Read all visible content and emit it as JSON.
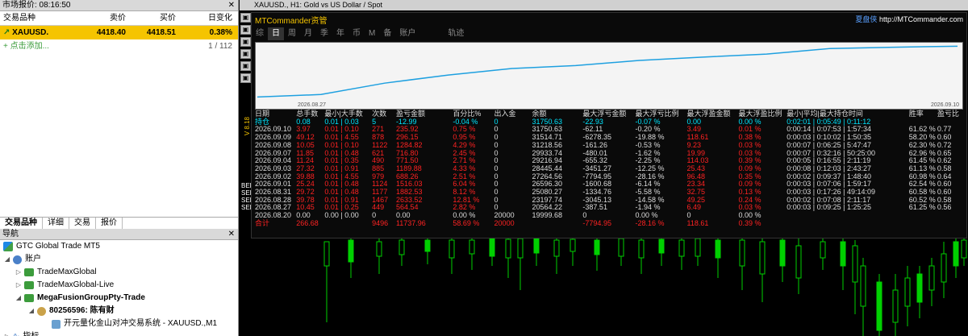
{
  "market_watch": {
    "title": "市场报价: 08:16:50",
    "columns": [
      "交易品种",
      "卖价",
      "买价",
      "日变化"
    ],
    "rows": [
      {
        "symbol": "XAUUSD.",
        "bid": "4418.40",
        "ask": "4418.51",
        "change": "0.38%"
      }
    ],
    "add_label": "+ 点击添加...",
    "count": "1 / 112",
    "tabs": [
      "交易品种",
      "详细",
      "交易",
      "报价"
    ]
  },
  "navigator": {
    "title": "导航",
    "broker": "GTC Global Trade MT5",
    "accounts_label": "账户",
    "accounts": [
      "TradeMaxGlobal",
      "TradeMaxGlobal-Live",
      "MegaFusionGroupPty-Trade"
    ],
    "user": "80256596: 陈有财",
    "ea": "开元量化金山对冲交易系统 - XAUUSD.,M1",
    "indicators": "指标"
  },
  "chart": {
    "title": "XAUUSD., H1:  Gold vs US Dollar / Spot",
    "vertical_label": "V 8.18",
    "side_text": [
      "BEE",
      "SEL",
      "SEL",
      "SEL"
    ]
  },
  "mtc": {
    "title": "MTCommander资管",
    "link_brand": "夏盘侠",
    "link_url": "http://MTCommander.com",
    "tabs": [
      "综",
      "日",
      "周",
      "月",
      "季",
      "年",
      "币",
      "M",
      "备",
      "账户",
      "轨迹"
    ],
    "active_tab": "日",
    "eq_start_date": "2026.08.27",
    "eq_end_date": "2026.09.10",
    "table": {
      "headers": [
        "日期",
        "总手数",
        "最小|大手数",
        "次数",
        "盈亏金额",
        "百分比%",
        "出入金",
        "余额",
        "最大浮亏金额",
        "最大浮亏比例",
        "最大浮盈金额",
        "最大浮盈比例",
        "最小|平均|最大持仓时间",
        "胜率",
        "盈亏比"
      ],
      "holding": [
        "持仓",
        "0.08",
        "0.01 | 0.03",
        "5",
        "-12.99",
        "-0.04 %",
        "0",
        "31750.63",
        "-22.93",
        "-0.07 %",
        "0.00",
        "0.00 %",
        "0:02:01 | 0:05:49 | 0:11:12",
        "",
        ""
      ],
      "rows": [
        [
          "2026.09.10",
          "3.97",
          "0.01 | 0.10",
          "271",
          "235.92",
          "0.75 %",
          "0",
          "31750.63",
          "-62.11",
          "-0.20 %",
          "3.49",
          "0.01 %",
          "0:00:14 | 0:07:53 | 1:57:34",
          "61.62 %",
          "0.77"
        ],
        [
          "2026.09.09",
          "49.12",
          "0.01 | 4.55",
          "878",
          "296.15",
          "0.95 %",
          "0",
          "31514.71",
          "-6278.35",
          "-19.88 %",
          "118.61",
          "0.38 %",
          "0:00:03 | 0:10:02 | 1:50:35",
          "58.20 %",
          "0.60"
        ],
        [
          "2026.09.08",
          "10.05",
          "0.01 | 0.10",
          "1122",
          "1284.82",
          "4.29 %",
          "0",
          "31218.56",
          "-161.26",
          "-0.53 %",
          "9.23",
          "0.03 %",
          "0:00:07 | 0:06:25 | 5:47:47",
          "62.30 %",
          "0.72"
        ],
        [
          "2026.09.07",
          "11.85",
          "0.01 | 0.48",
          "621",
          "716.80",
          "2.45 %",
          "0",
          "29933.74",
          "-480.01",
          "-1.62 %",
          "19.99",
          "0.03 %",
          "0:00:07 | 0:32:16 | 50:25:00",
          "62.96 %",
          "0.65"
        ],
        [
          "2026.09.04",
          "11.24",
          "0.01 | 0.35",
          "490",
          "771.50",
          "2.71 %",
          "0",
          "29216.94",
          "-655.32",
          "-2.25 %",
          "114.03",
          "0.39 %",
          "0:00:05 | 0:16:55 | 2:11:19",
          "61.45 %",
          "0.62"
        ],
        [
          "2026.09.03",
          "27.32",
          "0.01 | 0.91",
          "885",
          "1189.88",
          "4.33 %",
          "0",
          "28445.44",
          "-3451.27",
          "-12.25 %",
          "25.43",
          "0.09 %",
          "0:00:08 | 0:12:03 | 2:43:27",
          "61.13 %",
          "0.58"
        ],
        [
          "2026.09.02",
          "39.88",
          "0.01 | 4.55",
          "979",
          "688.26",
          "2.51 %",
          "0",
          "27264.56",
          "-7794.95",
          "-28.16 %",
          "96.48",
          "0.35 %",
          "0:00:02 | 0:09:37 | 1:48:40",
          "60.98 %",
          "0.64"
        ],
        [
          "2026.09.01",
          "25.24",
          "0.01 | 0.48",
          "1124",
          "1516.03",
          "6.04 %",
          "0",
          "26596.30",
          "-1600.68",
          "-6.14 %",
          "23.34",
          "0.09 %",
          "0:00:03 | 0:07:06 | 1:59:17",
          "62.54 %",
          "0.60"
        ],
        [
          "2026.08.31",
          "29.72",
          "0.01 | 0.48",
          "1177",
          "1882.53",
          "8.12 %",
          "0",
          "25080.27",
          "-1334.76",
          "-5.58 %",
          "32.75",
          "0.13 %",
          "0:00:03 | 0:17:26 | 49:14:09",
          "60.58 %",
          "0.60"
        ],
        [
          "2026.08.28",
          "39.78",
          "0.01 | 0.91",
          "1467",
          "2633.52",
          "12.81 %",
          "0",
          "23197.74",
          "-3045.13",
          "-14.58 %",
          "49.25",
          "0.24 %",
          "0:00:02 | 0:07:08 | 2:11:17",
          "60.52 %",
          "0.58"
        ],
        [
          "2026.08.27",
          "10.45",
          "0.01 | 0.25",
          "449",
          "564.54",
          "2.82 %",
          "0",
          "20564.22",
          "-387.51",
          "-1.94 %",
          "6.49",
          "0.03 %",
          "0:00:03 | 0:09:25 | 1:25:25",
          "61.25 %",
          "0.56"
        ]
      ],
      "start_row": [
        "2026.08.20",
        "0.00",
        "0.00 | 0.00",
        "0",
        "0.00",
        "0.00 %",
        "20000",
        "19999.68",
        "0",
        "0.00 %",
        "0",
        "0.00 %",
        "",
        "",
        ""
      ],
      "total": [
        "合计",
        "266.68",
        "",
        "9496",
        "11737.96",
        "58.69 %",
        "20000",
        "",
        "-7794.95",
        "-28.16 %",
        "118.61",
        "0.39 %",
        "",
        "",
        ""
      ]
    }
  },
  "colors": {
    "accent_yellow": "#f5c400",
    "equity_line": "#1ea0e0",
    "negative": "#ff2222",
    "holding": "#00e6ff",
    "bull_candle": "#00d000"
  }
}
